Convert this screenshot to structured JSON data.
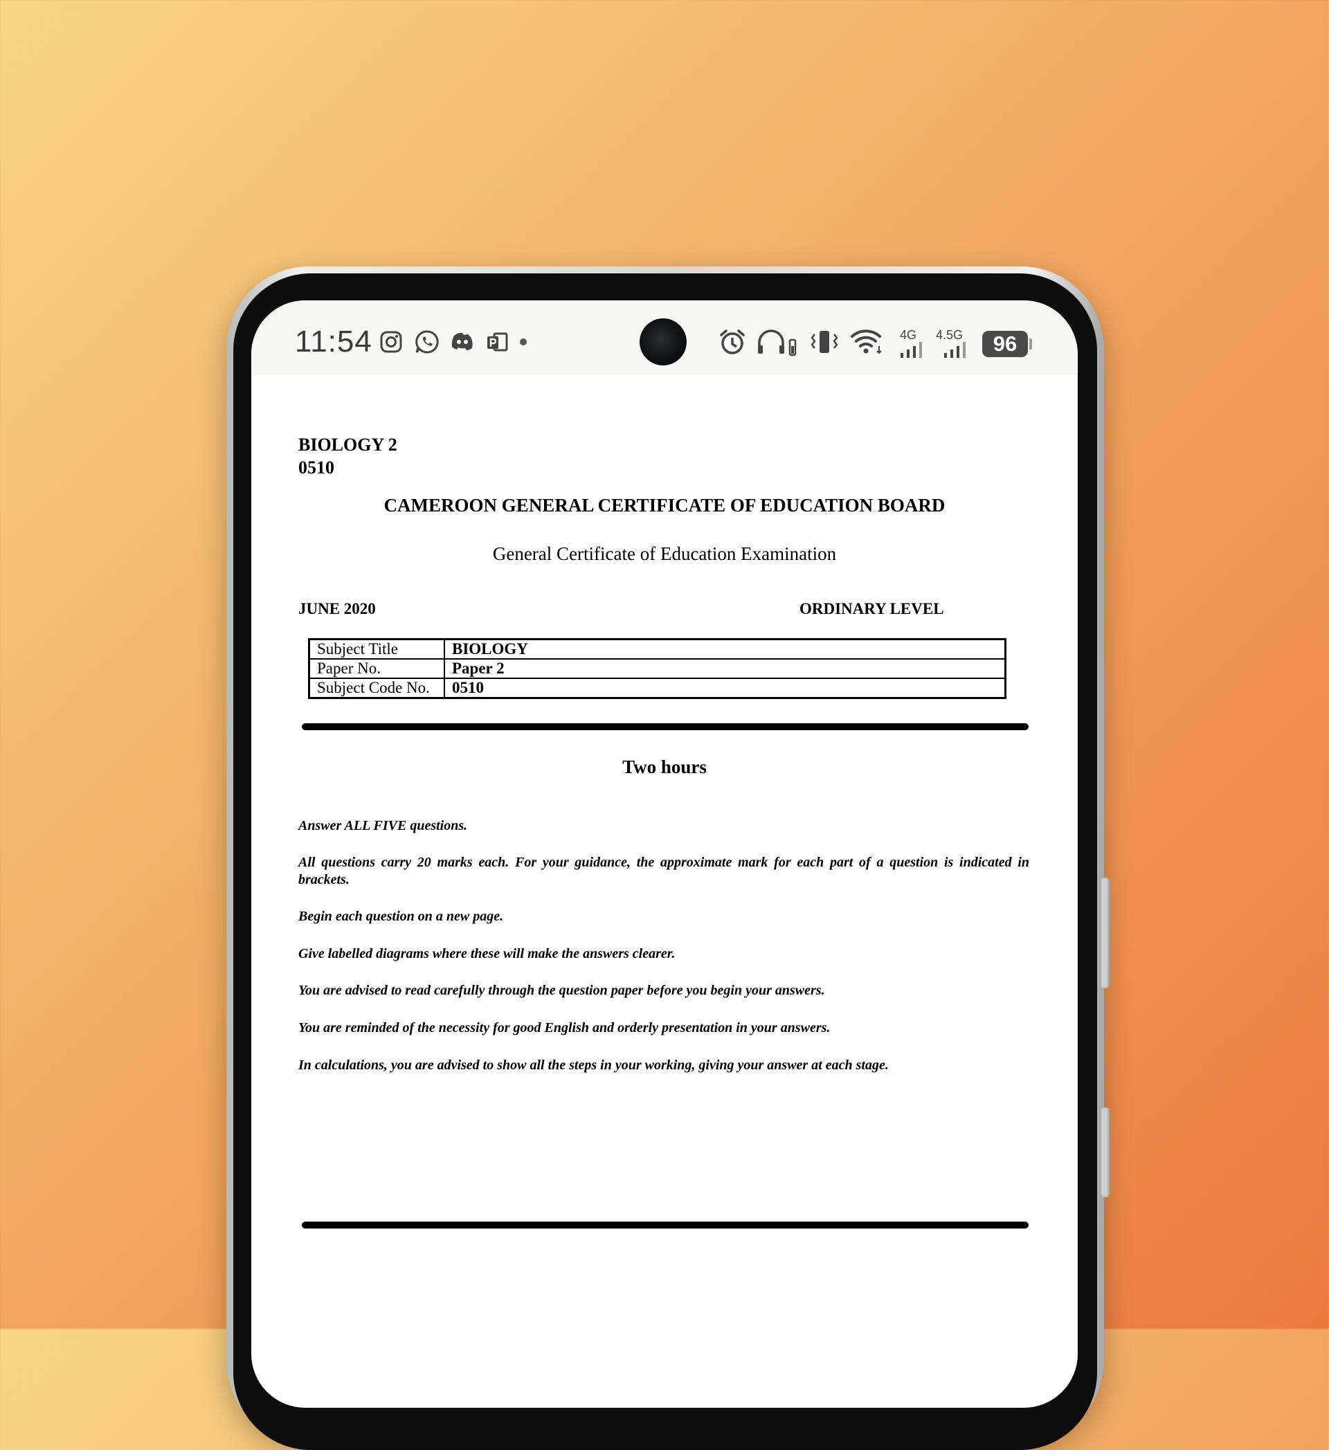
{
  "status_bar": {
    "time": "11:54",
    "notification_icons": [
      "instagram-icon",
      "whatsapp-icon",
      "discord-icon",
      "powerpoint-icon",
      "more-dot-icon"
    ],
    "system_icons": [
      "alarm-icon",
      "headphones-icon",
      "vibrate-icon",
      "wifi-icon",
      "signal-4g-icon",
      "signal-4.5g-icon"
    ],
    "network_1": "4G",
    "network_2": "4.5G",
    "battery": "96"
  },
  "document": {
    "subject_line_1": "BIOLOGY 2",
    "subject_line_2": "0510",
    "board": "CAMEROON GENERAL CERTIFICATE OF EDUCATION BOARD",
    "exam": "General Certificate of Education Examination",
    "date": "JUNE 2020",
    "level": "ORDINARY LEVEL",
    "info_table": [
      {
        "label": "Subject Title",
        "value": "BIOLOGY"
      },
      {
        "label": "Paper No.",
        "value": "Paper 2"
      },
      {
        "label": "Subject Code No.",
        "value": "0510"
      }
    ],
    "duration": "Two hours",
    "instructions": [
      "Answer ALL FIVE questions.",
      "All questions carry 20 marks each. For your guidance, the approximate mark for each part of a question is indicated in brackets.",
      "Begin each question on a new page.",
      "Give labelled diagrams where these will make the answers clearer.",
      "You are advised to read carefully through the question paper before you begin your answers.",
      "You are reminded of the necessity for good English and orderly presentation in your answers.",
      "In calculations, you are advised to show all the steps in your working, giving your answer at each stage."
    ]
  },
  "colors": {
    "background_start": "#f8d588",
    "background_end": "#ec7a40",
    "status_bar": "#f7f7f5",
    "document": "#ffffff",
    "battery_badge": "#4a4a4a"
  }
}
